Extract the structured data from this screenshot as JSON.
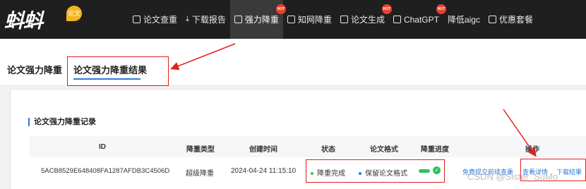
{
  "logo": {
    "text": "蚪蚪",
    "badge": "论文"
  },
  "nav": [
    {
      "label": "论文查重",
      "icon": "doc-icon",
      "hot": false,
      "active": false
    },
    {
      "label": "下载报告",
      "icon": "download-icon",
      "hot": false,
      "active": false
    },
    {
      "label": "强力降重",
      "icon": "image-icon",
      "hot": true,
      "active": true
    },
    {
      "label": "知网降重",
      "icon": "grid-icon",
      "hot": false,
      "active": false
    },
    {
      "label": "论文生成",
      "icon": "calendar-icon",
      "hot": true,
      "active": false
    },
    {
      "label": "ChatGPT",
      "icon": "chat-icon",
      "hot": true,
      "active": false
    },
    {
      "label": "降低aigc",
      "icon": "",
      "hot": false,
      "active": false
    },
    {
      "label": "优惠套餐",
      "icon": "chat-icon",
      "hot": false,
      "active": false
    }
  ],
  "nav_hot_label": "HOT",
  "tabs": {
    "tab1": "论文强力降重",
    "tab2": "论文强力降重结果"
  },
  "section_title": "论文强力降重记录",
  "table": {
    "headers": [
      "ID",
      "降重类型",
      "创建时间",
      "状态",
      "论文格式",
      "降重进度",
      "操作"
    ],
    "row": {
      "id": "5ACB8529E648408FA1287AFDB3C4506D",
      "type": "超级降重",
      "created": "2024-04-24 11:15:10",
      "status": "降重完成",
      "format": "保留论文格式",
      "progress": 1.0,
      "actions": [
        "免费提交前续查重",
        "查看详情",
        "下载结果"
      ]
    }
  },
  "colors": {
    "accent": "#2f7bd8",
    "success": "#2ec25c",
    "annotation": "#e02020"
  },
  "watermark": "CSDN @Sister_SuMo"
}
